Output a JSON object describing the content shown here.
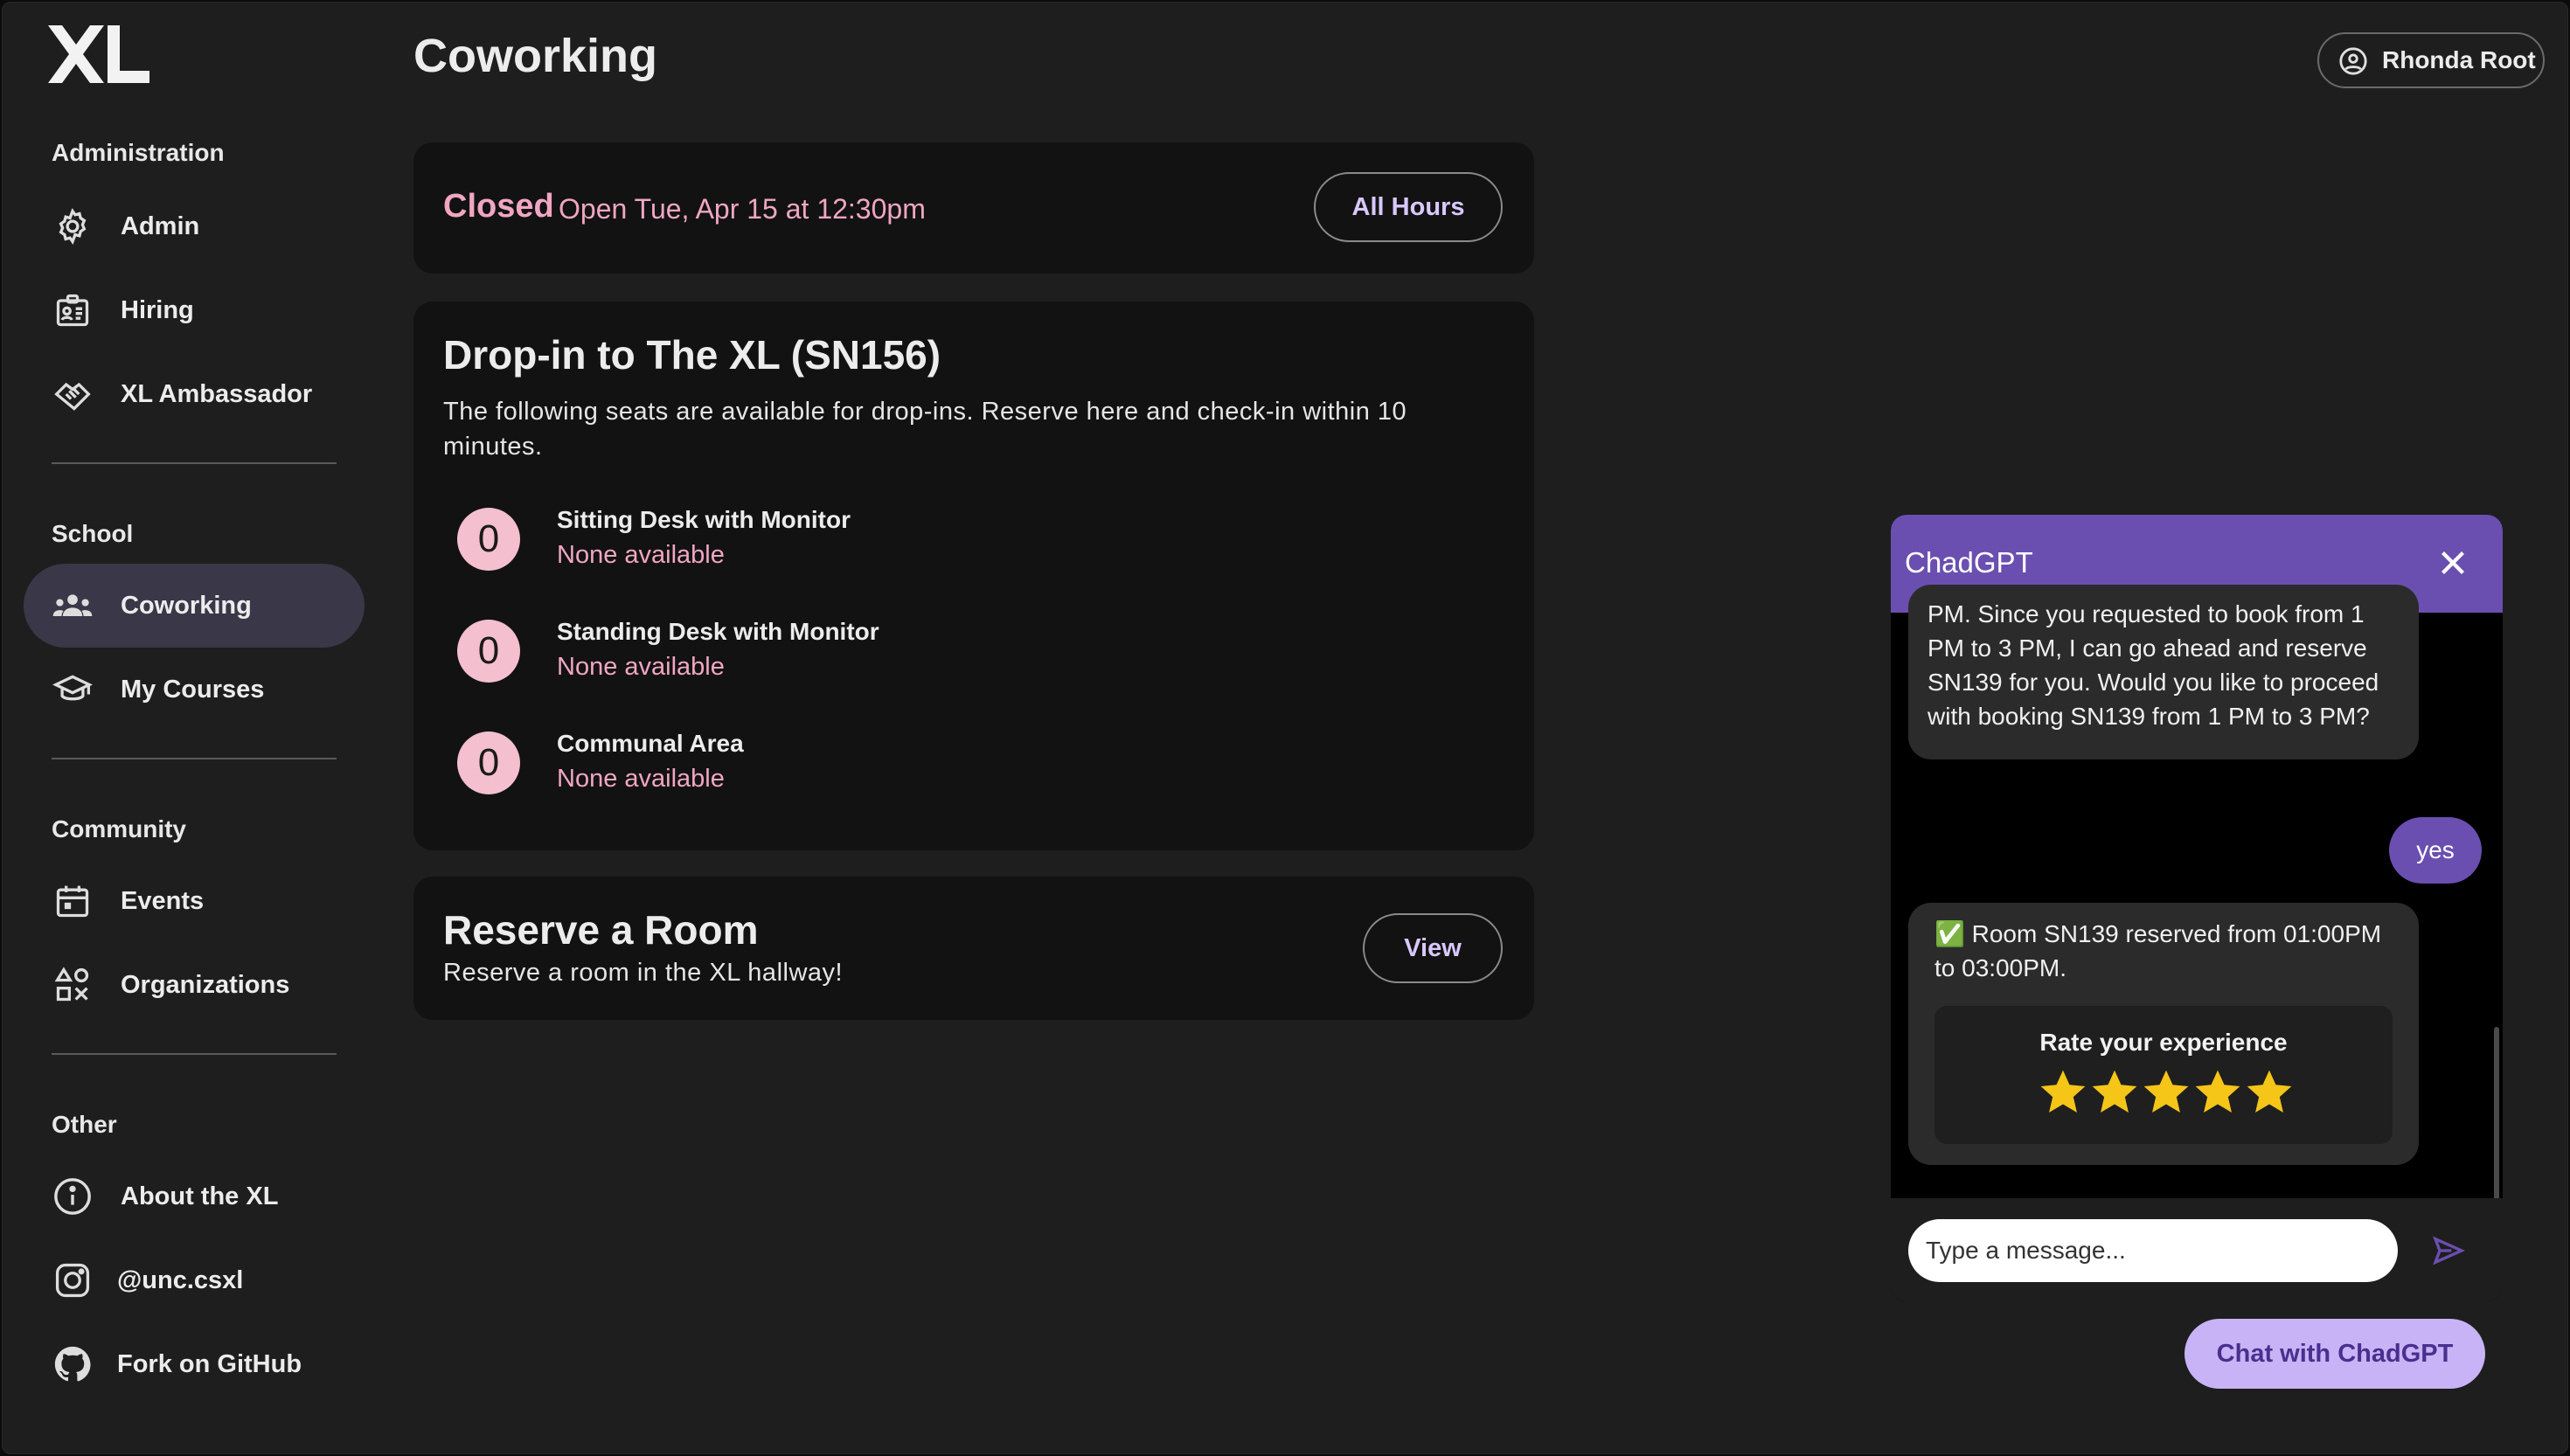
{
  "sidebar": {
    "logo_text": "XL",
    "sections": [
      {
        "title": "Administration",
        "items": [
          {
            "label": "Admin",
            "icon": "gear-icon"
          },
          {
            "label": "Hiring",
            "icon": "badge-icon"
          },
          {
            "label": "XL Ambassador",
            "icon": "handshake-icon"
          }
        ]
      },
      {
        "title": "School",
        "items": [
          {
            "label": "Coworking",
            "icon": "group-icon",
            "active": true
          },
          {
            "label": "My Courses",
            "icon": "graduation-cap-icon"
          }
        ]
      },
      {
        "title": "Community",
        "items": [
          {
            "label": "Events",
            "icon": "calendar-icon"
          },
          {
            "label": "Organizations",
            "icon": "shapes-icon"
          }
        ]
      },
      {
        "title": "Other",
        "items": [
          {
            "label": "About the XL",
            "icon": "info-icon"
          },
          {
            "label": "@unc.csxl",
            "icon": "instagram-icon"
          },
          {
            "label": "Fork on GitHub",
            "icon": "github-icon"
          }
        ]
      }
    ]
  },
  "header": {
    "title": "Coworking",
    "user_name": "Rhonda Root"
  },
  "status_card": {
    "status": "Closed",
    "next_open": "Open Tue, Apr 15 at 12:30pm",
    "button": "All Hours"
  },
  "dropin_card": {
    "title": "Drop-in to The XL (SN156)",
    "description": "The following seats are available for drop-ins. Reserve here and check-in within 10 minutes.",
    "seats": [
      {
        "count": "0",
        "name": "Sitting Desk with Monitor",
        "availability": "None available"
      },
      {
        "count": "0",
        "name": "Standing Desk with Monitor",
        "availability": "None available"
      },
      {
        "count": "0",
        "name": "Communal Area",
        "availability": "None available"
      }
    ]
  },
  "room_card": {
    "title": "Reserve a Room",
    "description": "Reserve a room in the XL hallway!",
    "button": "View"
  },
  "chat": {
    "title": "ChadGPT",
    "messages": [
      {
        "from": "bot",
        "text": "PM. Since you requested to book from 1 PM to 3 PM, I can go ahead and reserve SN139 for you. Would you like to proceed with booking SN139 from 1 PM to 3 PM?"
      },
      {
        "from": "user",
        "text": "yes"
      },
      {
        "from": "bot",
        "text": "✅ Room SN139 reserved from 01:00PM to 03:00PM."
      }
    ],
    "rating_title": "Rate your experience",
    "rating_stars": 5,
    "input_placeholder": "Type a message...",
    "launcher": "Chat with ChadGPT"
  },
  "colors": {
    "accent_purple": "#6a4fb0",
    "pink": "#f0a6c2",
    "star": "#f5c518"
  }
}
